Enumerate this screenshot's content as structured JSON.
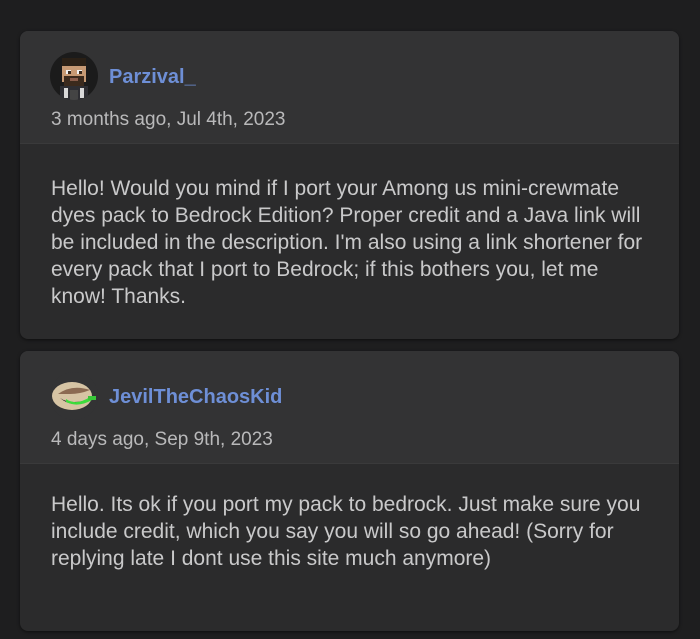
{
  "comments": [
    {
      "username": "Parzival_",
      "avatar_icon": "pixel-character-avatar",
      "timestamp": "3 months ago, Jul 4th, 2023",
      "body": "Hello! Would you mind if I port your Among us mini-crewmate dyes pack to Bedrock Edition? Proper credit and a Java link will be included in the description. I'm also using a link shortener for every pack that I port to Bedrock; if this bothers you, let me know! Thanks."
    },
    {
      "username": "JevilTheChaosKid",
      "avatar_icon": "grin-face-avatar",
      "timestamp": "4 days ago, Sep 9th, 2023",
      "body": "Hello. Its ok if you port my pack to bedrock. Just make sure you include credit, which you say you will so go ahead! (Sorry for replying late I dont use this site much anymore)"
    }
  ],
  "colors": {
    "page_bg": "#1e1e1f",
    "card_bg": "#2b2b2c",
    "header_bg": "#333334",
    "username": "#6e8fd6",
    "timestamp": "#b9b9ba",
    "body_text": "#c9c9ca"
  }
}
